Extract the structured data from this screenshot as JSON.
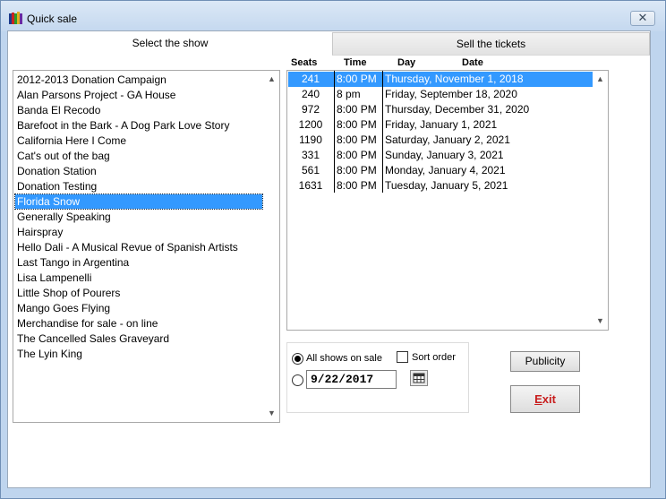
{
  "window": {
    "title": "Quick sale",
    "close_glyph": "✕"
  },
  "tabs": [
    {
      "label": "Select the show",
      "active": true
    },
    {
      "label": "Sell the tickets",
      "active": false
    }
  ],
  "shows": {
    "items": [
      "2012-2013 Donation Campaign",
      "Alan Parsons Project - GA House",
      "Banda El Recodo",
      "Barefoot in the Bark - A Dog Park Love Story",
      "California Here I Come",
      "Cat's out of the bag",
      "Donation Station",
      "Donation Testing",
      "Florida Snow",
      "Generally Speaking",
      "Hairspray",
      "Hello Dali - A Musical Revue of Spanish Artists",
      "Last Tango in Argentina",
      "Lisa Lampenelli",
      "Little Shop of Pourers",
      "Mango Goes Flying",
      "Merchandise for sale - on line",
      "The Cancelled Sales Graveyard",
      "The Lyin King"
    ],
    "selected_index": 8
  },
  "sessions": {
    "columns": {
      "seats": "Seats",
      "time": "Time",
      "day": "Day",
      "date": "Date"
    },
    "rows": [
      {
        "seats": "241",
        "time": "8:00 PM",
        "date": "Thursday, November 1, 2018"
      },
      {
        "seats": "240",
        "time": "8 pm",
        "date": "Friday, September 18, 2020"
      },
      {
        "seats": "972",
        "time": "8:00 PM",
        "date": "Thursday, December 31, 2020"
      },
      {
        "seats": "1200",
        "time": "8:00 PM",
        "date": "Friday, January 1, 2021"
      },
      {
        "seats": "1190",
        "time": "8:00 PM",
        "date": "Saturday, January 2, 2021"
      },
      {
        "seats": "331",
        "time": "8:00 PM",
        "date": "Sunday, January 3, 2021"
      },
      {
        "seats": "561",
        "time": "8:00 PM",
        "date": "Monday, January 4, 2021"
      },
      {
        "seats": "1631",
        "time": "8:00 PM",
        "date": "Tuesday, January 5, 2021"
      }
    ],
    "selected_index": 0
  },
  "filter": {
    "all_shows_label": "All shows on sale",
    "all_shows_checked": true,
    "sort_order_label": "Sort order",
    "sort_order_checked": false,
    "date_value": "9/22/2017"
  },
  "buttons": {
    "publicity": "Publicity",
    "exit_underlined": "E",
    "exit_rest": "xit"
  },
  "icons": {
    "app": "app-icon",
    "calendar": "calendar-icon",
    "close": "close-icon"
  },
  "colors": {
    "selection": "#3399ff",
    "exit_text": "#c81e1e"
  }
}
